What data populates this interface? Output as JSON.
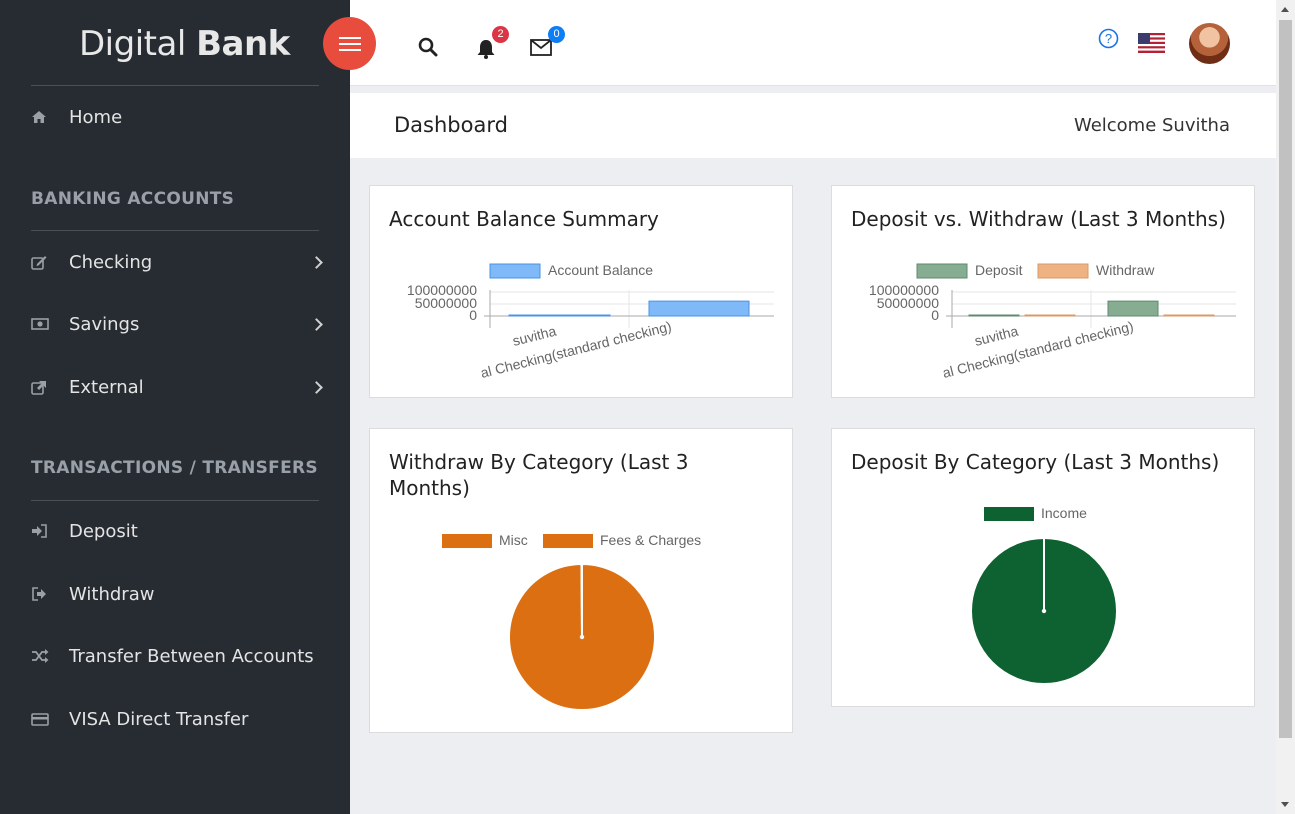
{
  "app": {
    "logo_light": "Digital",
    "logo_bold": "Bank"
  },
  "sidebar": {
    "home": "Home",
    "section_banking": "BANKING ACCOUNTS",
    "checking": "Checking",
    "savings": "Savings",
    "external": "External",
    "section_transactions": "TRANSACTIONS / TRANSFERS",
    "deposit": "Deposit",
    "withdraw": "Withdraw",
    "transfer": "Transfer Between Accounts",
    "visa": "VISA Direct Transfer"
  },
  "header": {
    "notifications_count": "2",
    "messages_count": "0",
    "help_icon": "question-circle-icon",
    "flag_icon": "us-flag-icon"
  },
  "page": {
    "title": "Dashboard",
    "welcome": "Welcome Suvitha"
  },
  "colors": {
    "sidebar_bg": "#272c33",
    "accent_red": "#e74c3c",
    "balance_blue": "#7fb9f7",
    "deposit_green": "#86ad92",
    "withdraw_orange": "#eeb283",
    "misc_orange": "#dc6f11",
    "income_green": "#0e6232"
  },
  "cards": {
    "balance_title": "Account Balance Summary",
    "depwith_title": "Deposit vs. Withdraw (Last 3 Months)",
    "withcat_title": "Withdraw By Category (Last 3 Months)",
    "depcat_title": "Deposit By Category (Last 3 Months)"
  },
  "chart_data": [
    {
      "type": "bar",
      "title": "Account Balance Summary",
      "categories": [
        "suvitha",
        "Individual Checking(standard checking)"
      ],
      "visible_category_labels": [
        "suvitha",
        "al Checking(standard checking)"
      ],
      "series": [
        {
          "name": "Account Balance",
          "values": [
            1000000,
            62000000
          ]
        }
      ],
      "y_ticks": [
        "100000000",
        "50000000",
        "0"
      ],
      "ylim": [
        0,
        100000000
      ],
      "legend": "top"
    },
    {
      "type": "bar",
      "title": "Deposit vs. Withdraw (Last 3 Months)",
      "categories": [
        "suvitha",
        "Individual Checking(standard checking)"
      ],
      "visible_category_labels": [
        "suvitha",
        "al Checking(standard checking)"
      ],
      "series": [
        {
          "name": "Deposit",
          "values": [
            1000000,
            62000000
          ]
        },
        {
          "name": "Withdraw",
          "values": [
            600000,
            600000
          ]
        }
      ],
      "y_ticks": [
        "100000000",
        "50000000",
        "0"
      ],
      "ylim": [
        0,
        100000000
      ],
      "legend": "top"
    },
    {
      "type": "pie",
      "title": "Withdraw By Category (Last 3 Months)",
      "labels": [
        "Misc",
        "Fees & Charges"
      ],
      "values": [
        99.9,
        0.1
      ],
      "colors": [
        "#dc6f11",
        "#dc6f11"
      ],
      "legend": "top"
    },
    {
      "type": "pie",
      "title": "Deposit By Category (Last 3 Months)",
      "labels": [
        "Income"
      ],
      "values": [
        100
      ],
      "colors": [
        "#0e6232"
      ],
      "legend": "top"
    }
  ]
}
